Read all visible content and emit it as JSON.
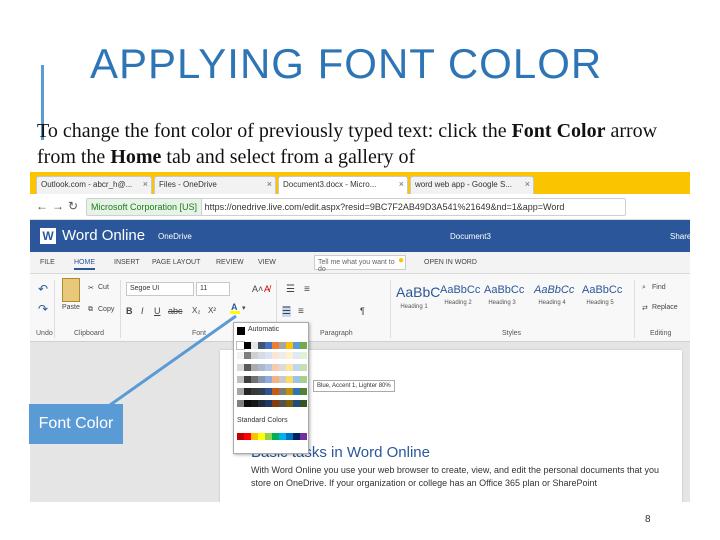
{
  "slide": {
    "title": "APPLYING FONT COLOR",
    "text_before_font_color": "To change the font color of previously typed text: click the ",
    "font_color_word": "Font Color",
    "text_middle": " arrow from the ",
    "home_word": "Home",
    "text_after": " tab and select from a gallery of",
    "callout_label": "Font Color",
    "page_number": "8",
    "accent_color": "#5b9bd5"
  },
  "browser": {
    "tabs": [
      {
        "label": "Outlook.com - abcr_h@..."
      },
      {
        "label": "Files - OneDrive"
      },
      {
        "label": "Document3.docx - Micro..."
      },
      {
        "label": "word web app - Google S..."
      }
    ],
    "address_secure_label": "Microsoft Corporation [US]",
    "address_url": "https://onedrive.live.com/edit.aspx?resid=9BC7F2AB49D3A541%21649&nd=1&app=Word"
  },
  "app": {
    "name": "Word Online",
    "onedrive_label": "OneDrive",
    "doc_name": "Document3",
    "share_label": "Share",
    "brand_color": "#2b579a"
  },
  "ribbon": {
    "tabs": [
      "FILE",
      "HOME",
      "INSERT",
      "PAGE LAYOUT",
      "REVIEW",
      "VIEW"
    ],
    "tell_me_placeholder": "Tell me what you want to do",
    "open_in_word": "OPEN IN WORD",
    "cut_label": "Cut",
    "copy_label": "Copy",
    "paste_label": "Paste",
    "undo_label": "Undo",
    "clipboard_label": "Clipboard",
    "font_group_label": "Font",
    "paragraph_group_label": "Paragraph",
    "styles_group_label": "Styles",
    "editing_group_label": "Editing",
    "font_name": "Segoe UI",
    "font_size": "11",
    "styles": [
      {
        "sample": "AaBbC",
        "name": "Heading 1"
      },
      {
        "sample": "AaBbCc",
        "name": "Heading 2"
      },
      {
        "sample": "AaBbCc",
        "name": "Heading 3"
      },
      {
        "sample": "AaBbCc",
        "name": "Heading 4"
      },
      {
        "sample": "AaBbCc",
        "name": "Heading 5"
      }
    ],
    "find_label": "Find",
    "replace_label": "Replace"
  },
  "color_gallery": {
    "automatic_label": "Automatic",
    "standard_label": "Standard Colors",
    "tooltip": "Blue, Accent 1, Lighter 80%",
    "theme_top": [
      "#ffffff",
      "#000000",
      "#e7e6e6",
      "#44546a",
      "#4472c4",
      "#ed7d31",
      "#a5a5a5",
      "#ffc000",
      "#5b9bd5",
      "#70ad47"
    ],
    "theme_shades": [
      [
        "#f2f2f2",
        "#7f7f7f",
        "#d0cece",
        "#d6dce4",
        "#dae3f3",
        "#fbe5d5",
        "#ededed",
        "#fff2cc",
        "#deebf6",
        "#e2efd9"
      ],
      [
        "#d8d8d8",
        "#595959",
        "#aeabab",
        "#adb9ca",
        "#b4c7e7",
        "#f8cbad",
        "#dbdbdb",
        "#fee599",
        "#bdd7ee",
        "#c5e0b3"
      ],
      [
        "#bfbfbf",
        "#3f3f3f",
        "#757070",
        "#8496b0",
        "#8faadc",
        "#f4b183",
        "#c9c9c9",
        "#ffd965",
        "#9cc3e5",
        "#a8d08d"
      ],
      [
        "#a5a5a5",
        "#262626",
        "#3a3838",
        "#323f4f",
        "#2f5496",
        "#c55a11",
        "#7b7b7b",
        "#bf9000",
        "#2e75b5",
        "#538135"
      ],
      [
        "#7f7f7f",
        "#0c0c0c",
        "#171616",
        "#222a35",
        "#1f3864",
        "#833c0b",
        "#525252",
        "#7f6000",
        "#1e4e79",
        "#375623"
      ]
    ],
    "standard": [
      "#c00000",
      "#ff0000",
      "#ffc000",
      "#ffff00",
      "#92d050",
      "#00b050",
      "#00b0f0",
      "#0070c0",
      "#002060",
      "#7030a0"
    ]
  },
  "document": {
    "heading": "Basic tasks in Word Online",
    "paragraph": "With Word Online you use your web browser to create, view, and edit the personal documents that you store on OneDrive. If your organization or college has an Office 365 plan or SharePoint"
  }
}
